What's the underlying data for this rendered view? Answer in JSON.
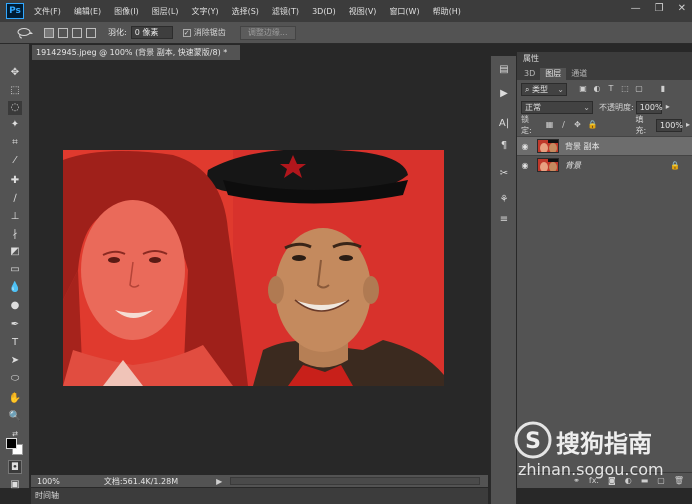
{
  "app": {
    "logo": "Ps"
  },
  "menu": [
    "文件(F)",
    "编辑(E)",
    "图像(I)",
    "图层(L)",
    "文字(Y)",
    "选择(S)",
    "滤镜(T)",
    "3D(D)",
    "视图(V)",
    "窗口(W)",
    "帮助(H)"
  ],
  "window_controls": {
    "minimize": "—",
    "restore": "❐",
    "close": "✕"
  },
  "options": {
    "feather_label": "羽化:",
    "feather_value": "0 像素",
    "antialias_label": "消除锯齿",
    "antialias_checked": "✓",
    "refine_edge_button": "调整边缘..."
  },
  "document": {
    "tab_title": "19142945.jpeg @ 100% (背景 副本, 快速蒙版/8) *",
    "tab_close": "×"
  },
  "status": {
    "zoom": "100%",
    "doc_info": "文档:561.4K/1.28M",
    "arrow": "▶"
  },
  "timeline": {
    "label": "时间轴"
  },
  "panels": {
    "top_label": "属性",
    "tabs": [
      "3D",
      "图层",
      "通道"
    ],
    "filter_kind": "类型",
    "blend_mode": "正常",
    "opacity_label": "不透明度:",
    "opacity_value": "100%",
    "lock_label": "锁定:",
    "fill_label": "填充:",
    "fill_value": "100%",
    "layers": [
      {
        "name": "背景 副本",
        "selected": true,
        "locked": false
      },
      {
        "name": "背景",
        "selected": false,
        "locked": true
      }
    ],
    "footer_icons": [
      "link-icon",
      "fx-icon",
      "mask-icon",
      "adjustment-icon",
      "folder-icon",
      "new-layer-icon",
      "trash-icon"
    ],
    "footer_fx": "fx."
  },
  "watermark": {
    "brand": "搜狗指南",
    "url": "zhinan.sogou.com",
    "logo_letter": "S"
  },
  "colors": {
    "overlay_red": "#e03a2e",
    "accent_blue": "#31a8ff"
  }
}
